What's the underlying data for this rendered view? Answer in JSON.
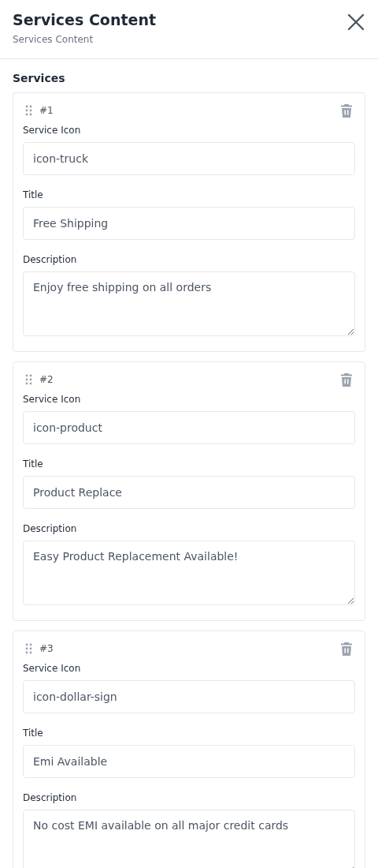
{
  "header": {
    "title": "Services Content",
    "subtitle": "Services Content"
  },
  "section": {
    "title": "Services"
  },
  "services": [
    {
      "number": "#1",
      "fields": [
        {
          "label": "Service Icon",
          "value": "icon-truck",
          "kind": "input"
        },
        {
          "label": "Title",
          "value": "Free Shipping",
          "kind": "input"
        },
        {
          "label": "Description",
          "value": "Enjoy free shipping on all orders",
          "kind": "textarea"
        }
      ]
    },
    {
      "number": "#2",
      "fields": [
        {
          "label": "Service Icon",
          "value": "icon-product",
          "kind": "input"
        },
        {
          "label": "Title",
          "value": "Product Replace",
          "kind": "input"
        },
        {
          "label": "Description",
          "value": "Easy Product Replacement Available!",
          "kind": "textarea"
        }
      ]
    },
    {
      "number": "#3",
      "fields": [
        {
          "label": "Service Icon",
          "value": "icon-dollar-sign",
          "kind": "input"
        },
        {
          "label": "Title",
          "value": "Emi Available",
          "kind": "input"
        },
        {
          "label": "Description",
          "value": "No cost EMI available on all major credit cards",
          "kind": "textarea"
        }
      ]
    }
  ]
}
